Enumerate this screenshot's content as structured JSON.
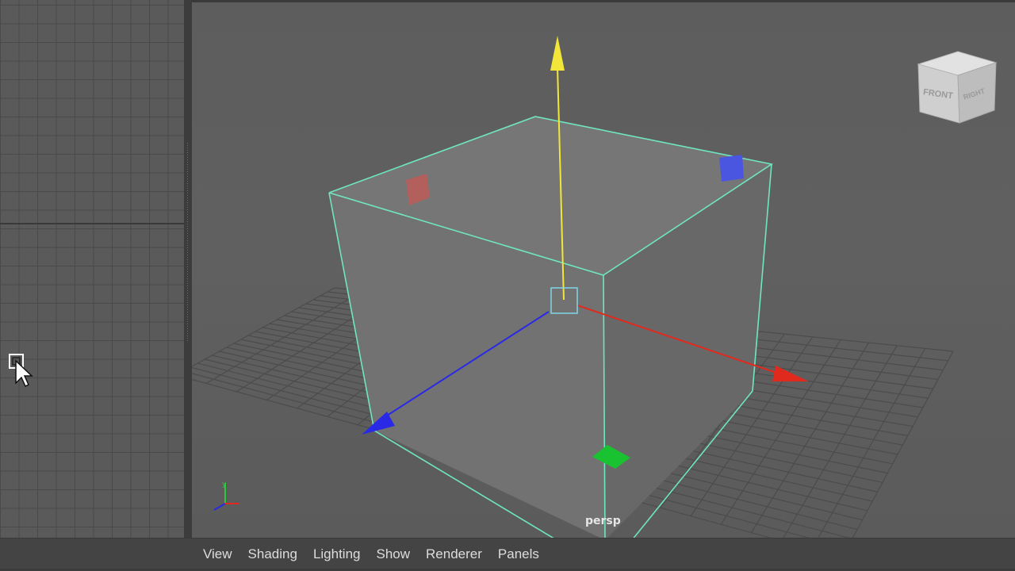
{
  "viewport": {
    "camera_label": "persp"
  },
  "panel_menu": {
    "items": [
      {
        "label": "View"
      },
      {
        "label": "Shading"
      },
      {
        "label": "Lighting"
      },
      {
        "label": "Show"
      },
      {
        "label": "Renderer"
      },
      {
        "label": "Panels"
      }
    ]
  },
  "view_cube": {
    "front_label": "FRONT",
    "right_label": "RIGHT"
  },
  "colors": {
    "selection_wireframe": "#6fe6c0",
    "axis_x": "#e02a1e",
    "axis_y": "#f2e63a",
    "axis_z": "#2a2ae6",
    "viewport_bg": "#5f5f5f",
    "menubar_bg": "#444444"
  },
  "icons": [
    "move-manipulator-icon",
    "axis-indicator-icon",
    "view-cube-icon",
    "mouse-cursor-icon"
  ]
}
